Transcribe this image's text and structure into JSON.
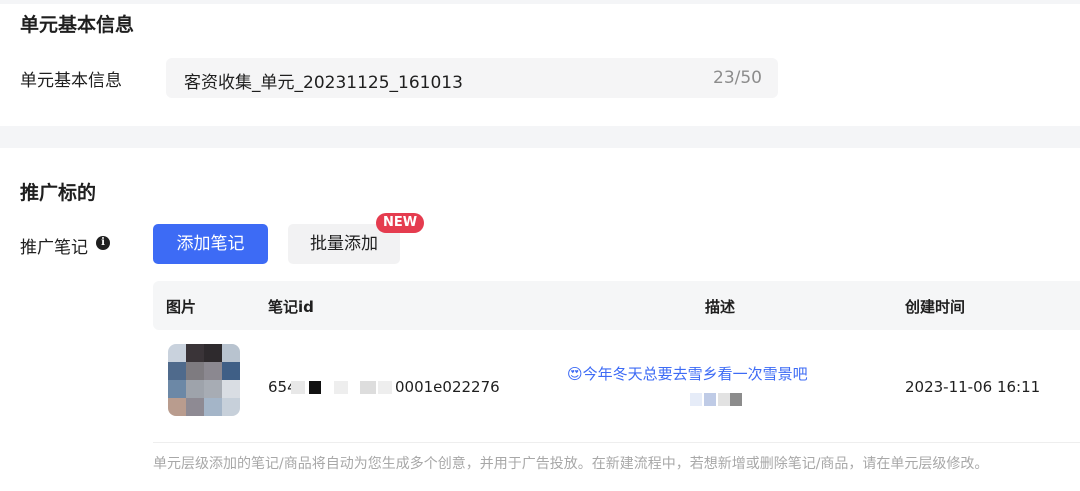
{
  "basic_info": {
    "section_title": "单元基本信息",
    "field_label": "单元基本信息",
    "unit_name": "客资收集_单元_20231125_161013",
    "char_counter": "23/50"
  },
  "promotion": {
    "section_title": "推广标的",
    "field_label": "推广笔记",
    "info_icon": "info-circle-icon",
    "add_button": "添加笔记",
    "batch_button": "批量添加",
    "new_badge": "NEW"
  },
  "notes_table": {
    "columns": [
      "图片",
      "笔记id",
      "描述",
      "创建时间"
    ],
    "rows": [
      {
        "image": "blurred-thumbnail",
        "note_id_prefix": "654",
        "note_id_suffix": "0001e022276",
        "description": "😍今年冬天总要去雪乡看一次雪景吧",
        "created_at": "2023-11-06 16:11"
      }
    ]
  },
  "footnote": "单元层级添加的笔记/商品将自动为您生成多个创意，并用于广告投放。在新建流程中，若想新增或删除笔记/商品，请在单元层级修改。",
  "colors": {
    "primary": "#3d6bf5",
    "badge": "#e53c4f",
    "page_bg": "#f4f5f7"
  }
}
